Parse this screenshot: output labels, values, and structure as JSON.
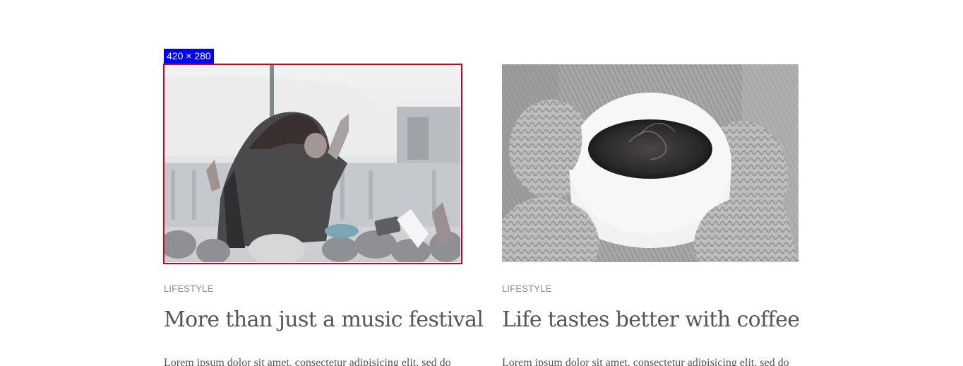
{
  "selection": {
    "dimension_label": "420 × 280"
  },
  "posts": [
    {
      "image_alt": "Woman raised above a festival crowd",
      "category": "LIFESTYLE",
      "title": "More than just a music festival",
      "excerpt": "Lorem ipsum dolor sit amet, consectetur adipisicing elit, sed do"
    },
    {
      "image_alt": "Knitted mittens holding a cup of coffee",
      "category": "LIFESTYLE",
      "title": "Life tastes better with coffee",
      "excerpt": "Lorem ipsum dolor sit amet, consectetur adipisicing elit, sed do"
    }
  ],
  "colors": {
    "selection_outline": "#d0021b",
    "dimension_badge": "#0000ff",
    "category_text": "#8a8a8a",
    "title_text": "#555555"
  }
}
